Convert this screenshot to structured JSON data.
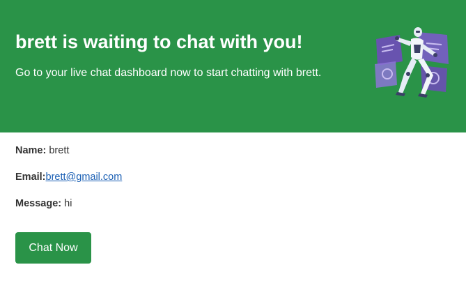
{
  "header": {
    "title": "brett is waiting to chat with you!",
    "subtitle": "Go to your live chat dashboard now to start chatting with brett.",
    "illustration_icon": "robot-illustration"
  },
  "details": {
    "name_label": "Name:",
    "name_value": "brett",
    "email_label": "Email:",
    "email_value": "brett@gmail.com",
    "message_label": "Message:",
    "message_value": "hi"
  },
  "action": {
    "chat_label": "Chat Now"
  },
  "colors": {
    "brand_green": "#2a9348",
    "link_blue": "#1a5fb4",
    "text_dark": "#333333"
  }
}
